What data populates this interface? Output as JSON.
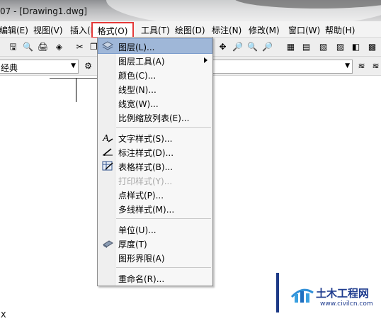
{
  "window": {
    "title": "07 - [Drawing1.dwg]"
  },
  "menubar": {
    "items": [
      {
        "label": "编辑(E)"
      },
      {
        "label": "视图(V)"
      },
      {
        "label": "插入(I)"
      },
      {
        "label": "格式(O)",
        "active": true
      },
      {
        "label": "工具(T)"
      },
      {
        "label": "绘图(D)"
      },
      {
        "label": "标注(N)"
      },
      {
        "label": "修改(M)"
      },
      {
        "label": "窗口(W)"
      },
      {
        "label": "帮助(H)"
      }
    ]
  },
  "toolbar2": {
    "workspace_value": "经典"
  },
  "format_menu": {
    "items": [
      {
        "label": "图层(L)...",
        "icon": "layers-icon",
        "highlighted": true
      },
      {
        "label": "图层工具(A)",
        "submenu": true
      },
      {
        "label": "颜色(C)..."
      },
      {
        "label": "线型(N)..."
      },
      {
        "label": "线宽(W)..."
      },
      {
        "label": "比例缩放列表(E)..."
      },
      {
        "label": "文字样式(S)...",
        "icon": "text-style-icon"
      },
      {
        "label": "标注样式(D)...",
        "icon": "dimension-style-icon"
      },
      {
        "label": "表格样式(B)...",
        "icon": "table-style-icon"
      },
      {
        "label": "打印样式(Y)...",
        "disabled": true
      },
      {
        "label": "点样式(P)..."
      },
      {
        "label": "多线样式(M)..."
      },
      {
        "label": "单位(U)..."
      },
      {
        "label": "厚度(T)",
        "icon": "thickness-icon"
      },
      {
        "label": "图形界限(A)"
      },
      {
        "label": "重命名(R)..."
      }
    ]
  },
  "ucs": {
    "x_label": "X"
  },
  "watermark": {
    "name": "土木工程网",
    "url": "www.civilcn.com"
  },
  "colors": {
    "highlight": "#9fb7d8",
    "callout_red": "#e53a3a",
    "watermark_blue": "#1f3c8f"
  }
}
